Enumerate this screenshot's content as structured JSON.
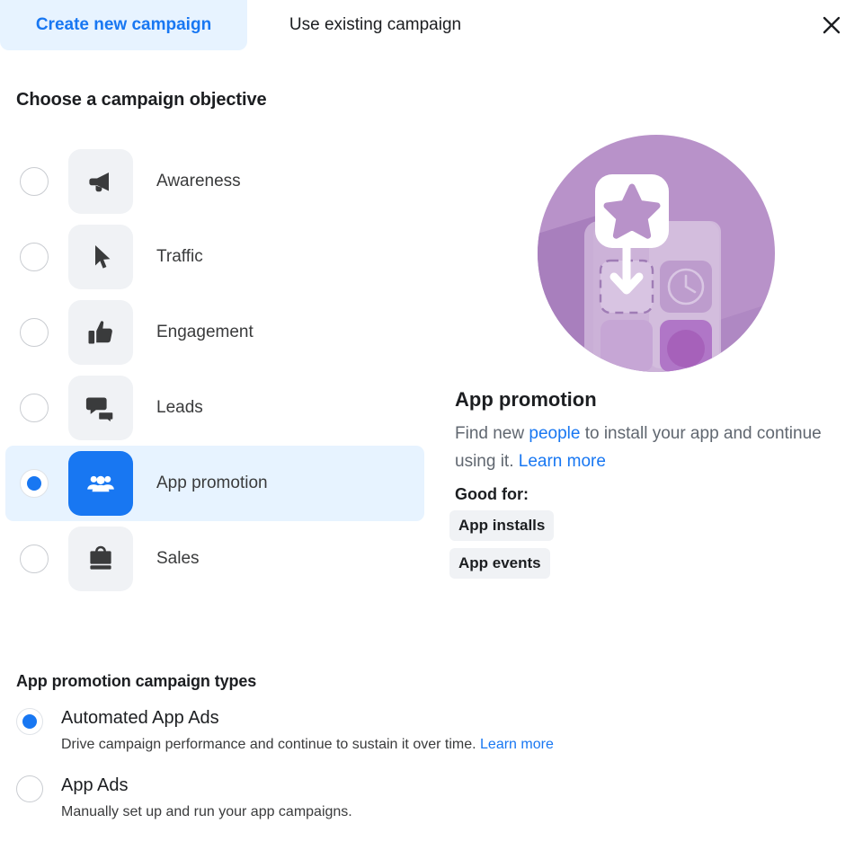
{
  "tabs": [
    {
      "label": "Create new campaign",
      "active": true
    },
    {
      "label": "Use existing campaign",
      "active": false
    }
  ],
  "close_label": "close-icon",
  "objective_section": {
    "heading": "Choose a campaign objective",
    "items": [
      {
        "label": "Awareness",
        "icon": "megaphone-icon",
        "selected": false
      },
      {
        "label": "Traffic",
        "icon": "cursor-arrow-icon",
        "selected": false
      },
      {
        "label": "Engagement",
        "icon": "thumbs-up-icon",
        "selected": false
      },
      {
        "label": "Leads",
        "icon": "speech-bubbles-icon",
        "selected": false
      },
      {
        "label": "App promotion",
        "icon": "people-group-icon",
        "selected": true
      },
      {
        "label": "Sales",
        "icon": "briefcase-icon",
        "selected": false
      }
    ]
  },
  "preview": {
    "illustration": "app-promotion-illustration",
    "title": "App promotion",
    "desc_part1": "Find new ",
    "desc_link1": "people",
    "desc_part2": " to install your app and continue using it. ",
    "desc_link2": "Learn more",
    "good_for_label": "Good for:",
    "chips": [
      "App installs",
      "App events"
    ]
  },
  "campaign_types": {
    "heading": "App promotion campaign types",
    "options": [
      {
        "name": "Automated App Ads",
        "desc": "Drive campaign performance and continue to sustain it over time. ",
        "link": "Learn more",
        "selected": true
      },
      {
        "name": "App Ads",
        "desc": "Manually set up and run your app campaigns.",
        "link": "",
        "selected": false
      }
    ]
  },
  "colors": {
    "accent": "#1877f2",
    "accent_bg": "#e7f3ff",
    "tile_bg": "#f0f2f5",
    "text": "#1c1e21",
    "muted": "#606770",
    "illustration_purple": "#b48fc4"
  }
}
